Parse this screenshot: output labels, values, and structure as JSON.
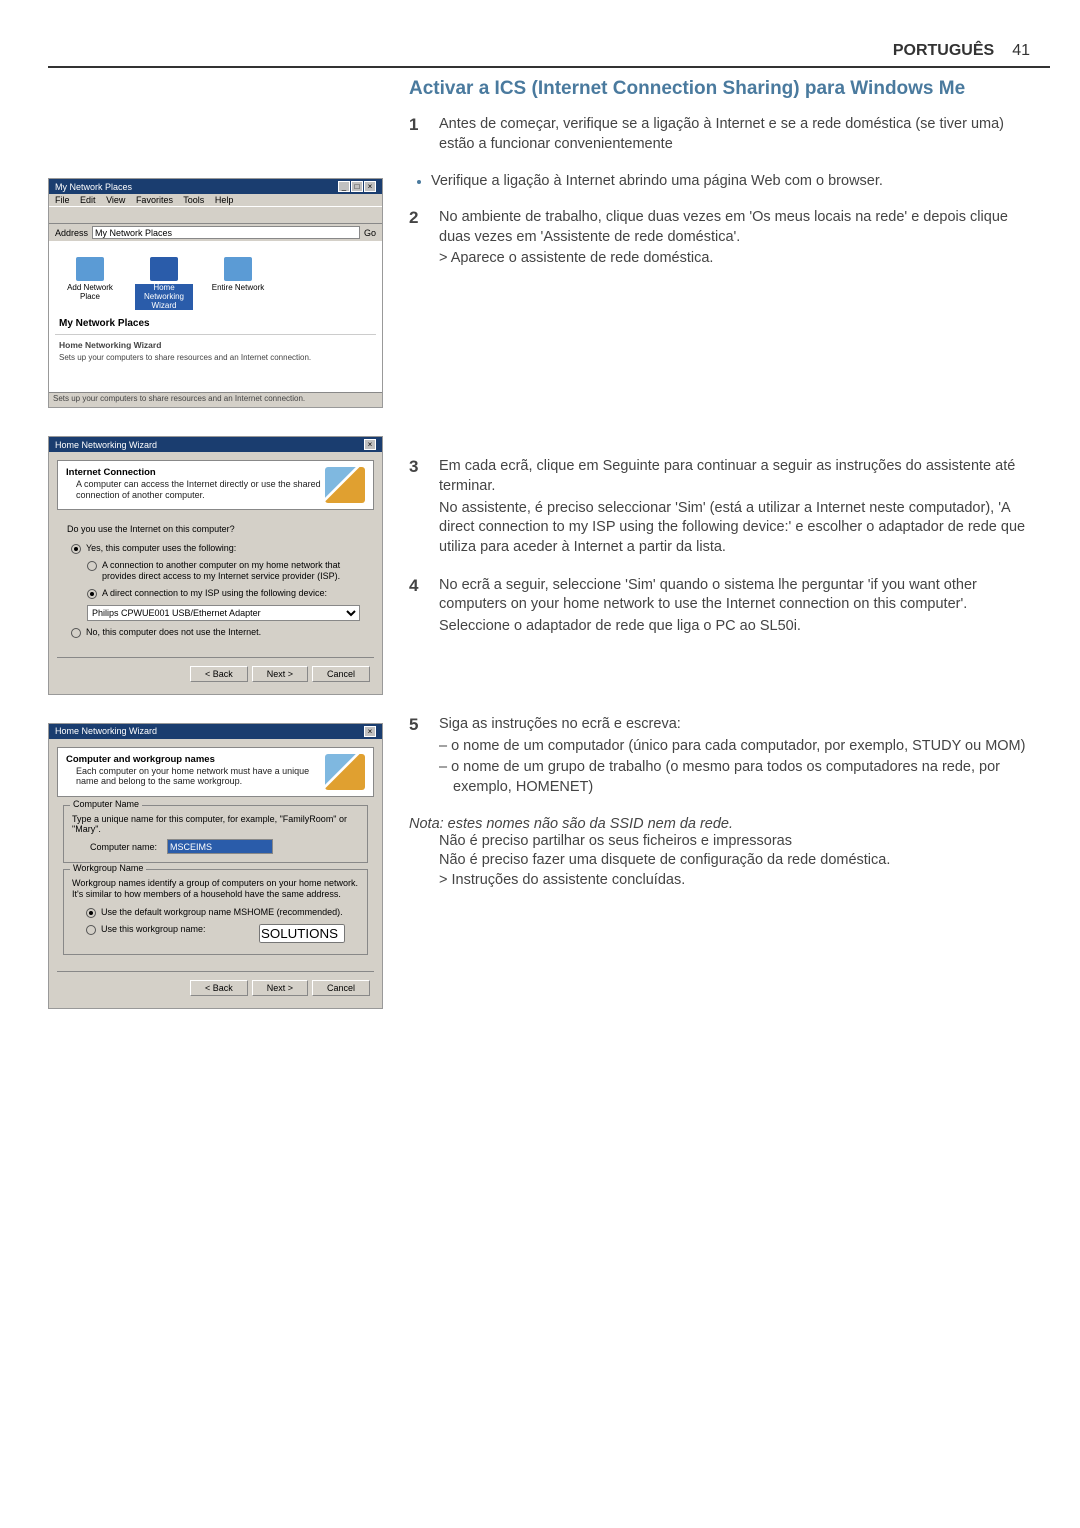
{
  "header": {
    "lang": "PORTUGUÊS",
    "page": "41"
  },
  "title": "Activar a ICS (Internet Connection Sharing) para Windows Me",
  "steps": {
    "s1": {
      "num": "1",
      "l1": "Antes de começar, verifique se a ligação à Internet e se a rede doméstica (se tiver uma) estão a funcionar convenientemente"
    },
    "b1": "Verifique a ligação à Internet abrindo uma página Web com o browser.",
    "s2": {
      "num": "2",
      "l1": "No ambiente de trabalho, clique duas vezes em 'Os meus locais na rede' e depois clique duas vezes em 'Assistente de rede doméstica'.",
      "l2": "> Aparece o assistente de rede doméstica."
    },
    "s3": {
      "num": "3",
      "l1": "Em cada ecrã, clique em Seguinte para continuar a seguir as instruções do assistente até terminar.",
      "l2": "No assistente, é preciso seleccionar 'Sim' (está a utilizar a Internet neste computador), 'A direct connection to my ISP using the following device:' e escolher o adaptador de rede que utiliza para aceder à Internet a partir da lista."
    },
    "s4": {
      "num": "4",
      "l1": "No ecrã a seguir, seleccione 'Sim' quando o sistema lhe perguntar 'if you want other computers on your home network to use the Internet connection on this computer'.",
      "l2": "Seleccione o adaptador de rede que liga o PC ao SL50i."
    },
    "s5": {
      "num": "5",
      "l1": "Siga as instruções no ecrã e escreva:",
      "l2": "– o nome de um computador (único para cada computador, por exemplo, STUDY ou MOM)",
      "l3": "– o nome de um grupo de trabalho (o mesmo para todos os computadores na rede, por exemplo, HOMENET)"
    }
  },
  "note": {
    "t": "Nota: estes nomes não são da SSID nem da rede.",
    "l1": "Não é preciso partilhar os seus ficheiros e impressoras",
    "l2": "Não é preciso fazer uma disquete de configuração da rede doméstica.",
    "l3": "> Instruções do assistente concluídas."
  },
  "scr1": {
    "title": "My Network Places",
    "menu": {
      "file": "File",
      "edit": "Edit",
      "view": "View",
      "fav": "Favorites",
      "tools": "Tools",
      "help": "Help"
    },
    "addrLabel": "Address",
    "addrVal": "My Network Places",
    "go": "Go",
    "icons": {
      "a": "Add Network Place",
      "b": "Home Networking Wizard",
      "c": "Entire Network"
    },
    "heading": "My Network Places",
    "sub": "Home Networking Wizard",
    "desc": "Sets up your computers to share resources and an Internet connection.",
    "status": "Sets up your computers to share resources and an Internet connection."
  },
  "scr2": {
    "title": "Home Networking Wizard",
    "h": "Internet Connection",
    "d": "A computer can access the Internet directly or use the shared connection of another computer.",
    "q": "Do you use the Internet on this computer?",
    "r1": "Yes, this computer uses the following:",
    "r1a": "A connection to another computer on my home network that provides direct access to my Internet service provider (ISP).",
    "r1b": "A direct connection to my ISP using the following device:",
    "sel": "Philips CPWUE001 USB/Ethernet Adapter",
    "r2": "No, this computer does not use the Internet.",
    "back": "< Back",
    "next": "Next >",
    "cancel": "Cancel"
  },
  "scr3": {
    "title": "Home Networking Wizard",
    "h": "Computer and workgroup names",
    "d": "Each computer on your home network must have a unique name and belong to the same workgroup.",
    "g1": "Computer Name",
    "g1d": "Type a unique name for this computer, for example, \"FamilyRoom\" or \"Mary\".",
    "g1l": "Computer name:",
    "g1v": "MSCEIMS",
    "g2": "Workgroup Name",
    "g2d": "Workgroup names identify a group of computers on your home network. It's similar to how members of a household have the same address.",
    "g2r1": "Use the default workgroup name MSHOME (recommended).",
    "g2r2": "Use this workgroup name:",
    "g2v": "SOLUTIONS",
    "back": "< Back",
    "next": "Next >",
    "cancel": "Cancel"
  }
}
